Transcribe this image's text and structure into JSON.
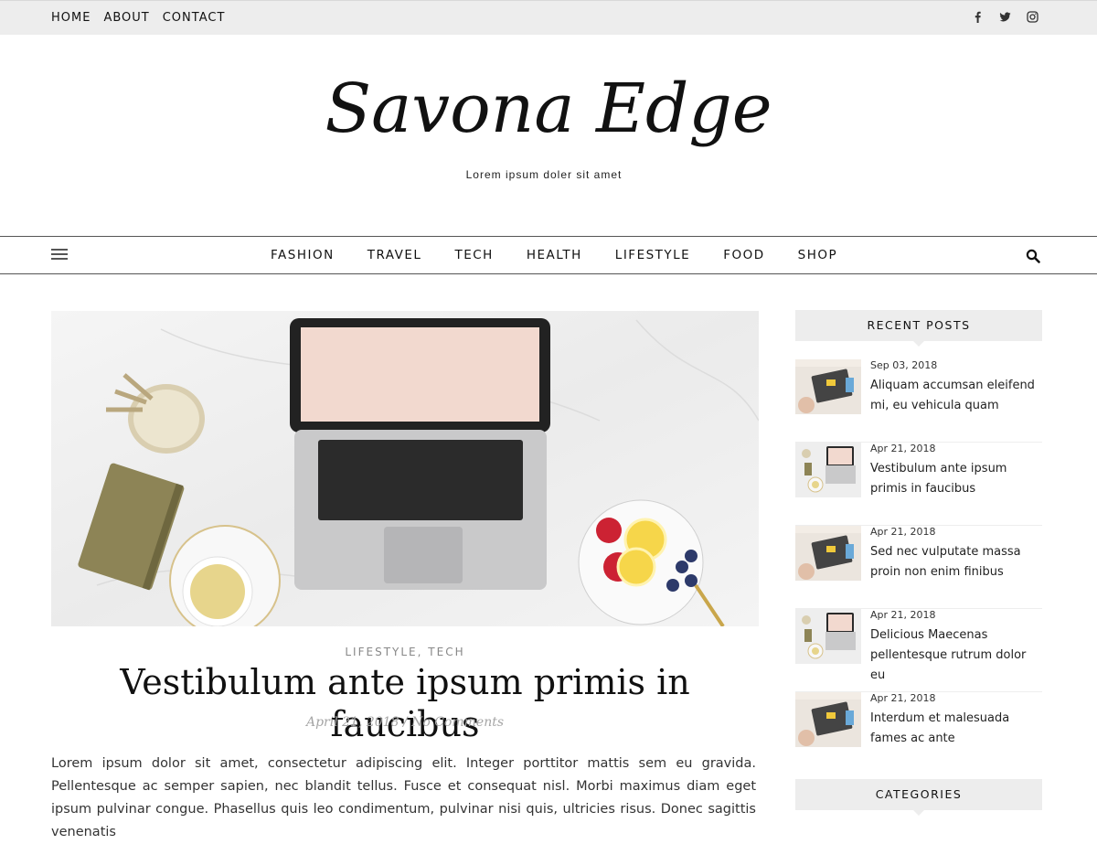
{
  "topbar": {
    "nav": [
      "HOME",
      "ABOUT",
      "CONTACT"
    ],
    "social_icons": [
      "facebook-icon",
      "twitter-icon",
      "instagram-icon"
    ]
  },
  "header": {
    "site_title": "Savona Edge",
    "tagline": "Lorem ipsum doler sit amet"
  },
  "mainnav": {
    "items": [
      "FASHION",
      "TRAVEL",
      "TECH",
      "HEALTH",
      "LIFESTYLE",
      "FOOD",
      "SHOP"
    ],
    "menu_icon": "hamburger-icon",
    "search_icon": "search-icon"
  },
  "post": {
    "categories": [
      "LIFESTYLE",
      "TECH"
    ],
    "category_separator": ", ",
    "title": "Vestibulum ante ipsum primis in faucibus",
    "date": "April 21, 2018",
    "meta_separator": " / ",
    "comments": "No Comments",
    "excerpt": "Lorem ipsum dolor sit amet, consectetur adipiscing elit. Integer porttitor mattis sem eu gravida. Pellentesque ac semper sapien, nec blandit tellus. Fusce et consequat nisl. Morbi maximus diam eget ipsum pulvinar congue. Phasellus quis leo condimentum, pulvinar nisi quis, ultricies risus. Donec sagittis venenatis"
  },
  "sidebar": {
    "recent_title": "RECENT POSTS",
    "recent_posts": [
      {
        "date": "Sep 03, 2018",
        "title": "Aliquam accumsan eleifend mi, eu vehicula quam",
        "thumb": "desk"
      },
      {
        "date": "Apr 21, 2018",
        "title": "Vestibulum ante ipsum primis in faucibus",
        "thumb": "laptop"
      },
      {
        "date": "Apr 21, 2018",
        "title": "Sed nec vulputate massa proin non enim finibus",
        "thumb": "desk"
      },
      {
        "date": "Apr 21, 2018",
        "title": "Delicious Maecenas pellentesque rutrum dolor eu",
        "thumb": "laptop"
      },
      {
        "date": "Apr 21, 2018",
        "title": "Interdum et malesuada fames ac ante",
        "thumb": "desk"
      }
    ],
    "categories_title": "CATEGORIES"
  }
}
